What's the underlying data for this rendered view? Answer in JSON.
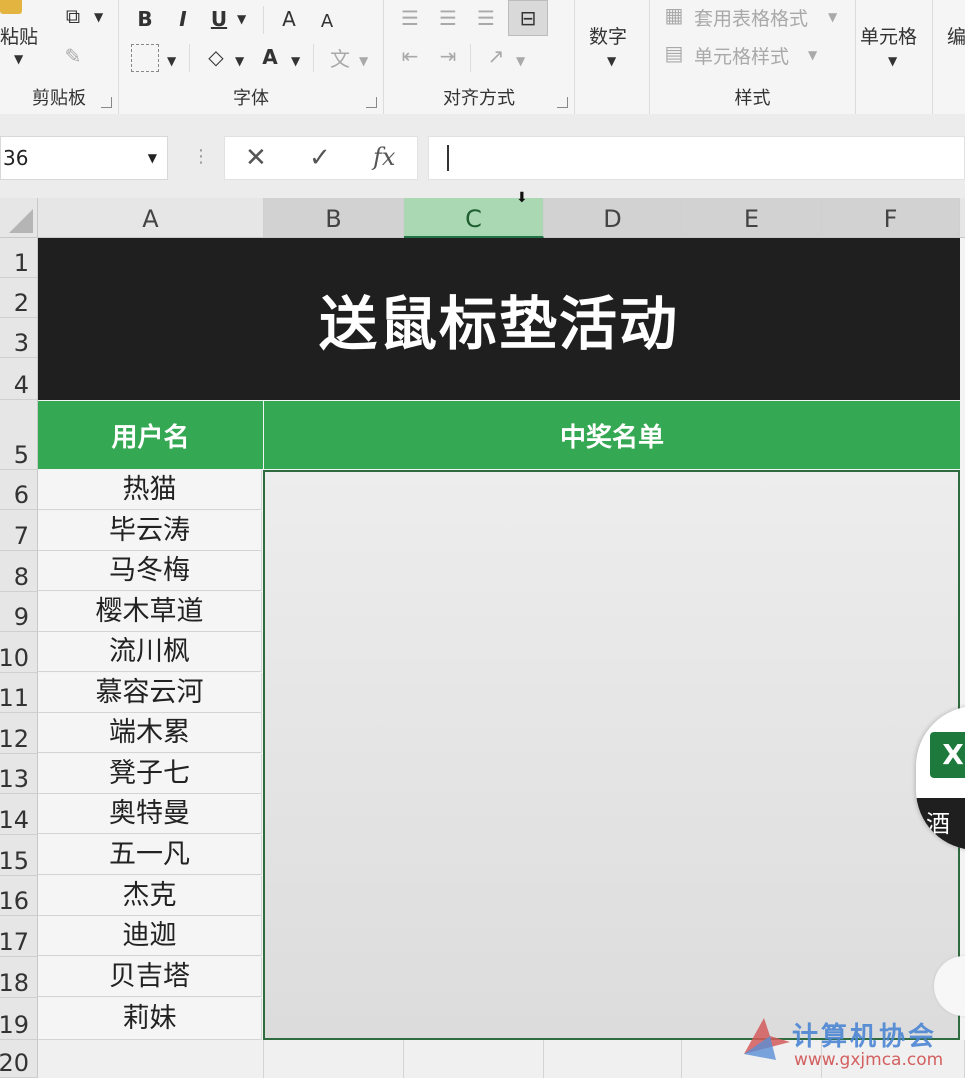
{
  "ribbon": {
    "clipboard": {
      "paste_label": "粘贴",
      "group_label": "剪贴板"
    },
    "font": {
      "bold": "B",
      "italic": "I",
      "underline": "U",
      "grow_font": "A",
      "shrink_font": "A",
      "font_color": "A",
      "phonetic": "文",
      "group_label": "字体"
    },
    "alignment": {
      "group_label": "对齐方式"
    },
    "number": {
      "label": "数字"
    },
    "styles": {
      "table_format": "套用表格格式",
      "cell_styles": "单元格样式",
      "group_label": "样式"
    },
    "cells": {
      "label": "单元格"
    },
    "editing": {
      "label": "编"
    }
  },
  "formula_bar": {
    "name_box": "36",
    "cancel": "✕",
    "enter": "✓",
    "fx": "fx",
    "content": ""
  },
  "columns": [
    "A",
    "B",
    "C",
    "D",
    "E",
    "F"
  ],
  "rows": [
    "1",
    "2",
    "3",
    "4",
    "5",
    "6",
    "7",
    "8",
    "9",
    "10",
    "11",
    "12",
    "13",
    "14",
    "15",
    "16",
    "17",
    "18",
    "19",
    "20"
  ],
  "sheet": {
    "title": "送鼠标垫活动",
    "header_user": "用户名",
    "header_winners": "中奖名单",
    "users": [
      "热猫",
      "毕云涛",
      "马冬梅",
      "樱木草道",
      "流川枫",
      "慕容云河",
      "端木累",
      "凳子七",
      "奥特曼",
      "五一凡",
      "杰克",
      "迪迦",
      "贝吉塔",
      "莉妹"
    ]
  },
  "overlay": {
    "badge_letter": "X",
    "badge_text": "酒"
  },
  "watermark": {
    "main": "计算机协会",
    "sub": "www.gxjmca.com"
  }
}
